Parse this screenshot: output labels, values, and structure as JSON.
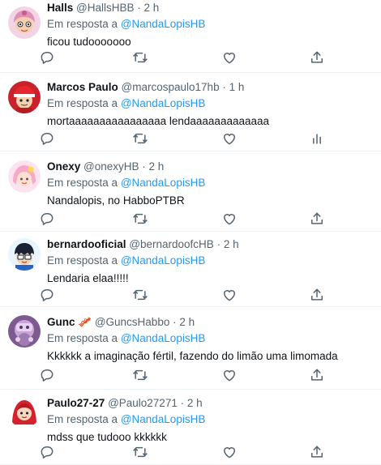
{
  "reply_prefix": "Em resposta a",
  "colors": {
    "name": "#0f1419",
    "meta": "#536471",
    "mention": "#1d9bf0",
    "divider": "#eff3f4"
  },
  "tweets": [
    {
      "name": "Halls",
      "handle": "@HallsHBB",
      "time": "· 2 h",
      "reply_to": "@NandaLopisHB",
      "text": "ficou tudooooooo",
      "has_analytics": false,
      "avatar": "pink-haired-avatar"
    },
    {
      "name": "Marcos Paulo",
      "handle": "@marcospaulo17hb",
      "time": "· 1 h",
      "reply_to": "@NandaLopisHB",
      "text": "mortaaaaaaaaaaaaaaaa lendaaaaaaaaaaaaa",
      "has_analytics": true,
      "avatar": "red-cap-avatar"
    },
    {
      "name": "Onexy",
      "handle": "@onexyHB",
      "time": "· 2 h",
      "reply_to": "@NandaLopisHB",
      "text": "Nandalopis, no HabboPTBR",
      "has_analytics": false,
      "avatar": "pastel-avatar"
    },
    {
      "name": "bernardooficial",
      "handle": "@bernardoofcHB",
      "time": "· 2 h",
      "reply_to": "@NandaLopisHB",
      "text": "Lendaria elaa!!!!!",
      "has_analytics": false,
      "avatar": "dark-hair-avatar"
    },
    {
      "name": "Gunc 🥓",
      "handle": "@GuncsHabbo",
      "time": "· 2 h",
      "reply_to": "@NandaLopisHB",
      "text": "Kkkkkk a imaginação fértil, fazendo do limão uma limomada",
      "has_analytics": false,
      "avatar": "purple-avatar"
    },
    {
      "name": "Paulo27-27",
      "handle": "@Paulo27271",
      "time": "· 2 h",
      "reply_to": "@NandaLopisHB",
      "text": "mdss que tudooo kkkkkk",
      "has_analytics": false,
      "avatar": "red-hair-avatar"
    }
  ]
}
